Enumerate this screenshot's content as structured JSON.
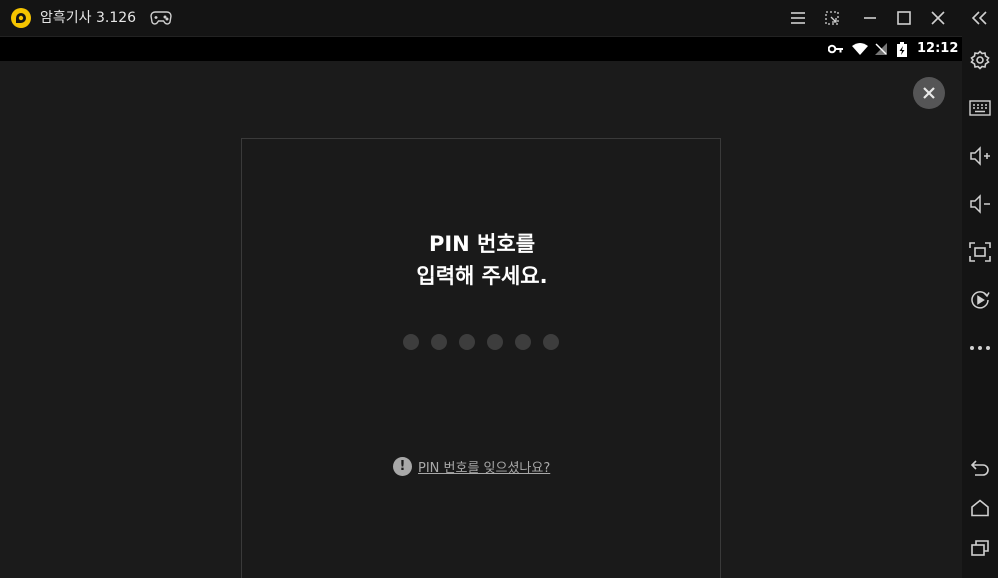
{
  "window": {
    "title": "암흑기사 3.126",
    "logo_icon": "ldplayer-logo-icon",
    "accent_color": "#f5c400"
  },
  "titlebar": {
    "buttons": [
      "menu-icon",
      "resize-icon",
      "minimize-icon",
      "maximize-icon",
      "close-icon"
    ]
  },
  "statusbar": {
    "time": "12:12",
    "icons": [
      "vpn-key-icon",
      "wifi-icon",
      "no-signal-icon",
      "battery-charging-icon"
    ]
  },
  "pin_dialog": {
    "title_line1": "PIN 번호를",
    "title_line2": "입력해 주세요.",
    "dot_count": 6,
    "forgot_icon_glyph": "!",
    "forgot_link": "PIN 번호를 잊으셨나요?"
  },
  "sidebar": {
    "buttons": [
      "collapse-icon",
      "settings-icon",
      "keyboard-icon",
      "volume-up-icon",
      "volume-down-icon",
      "fullscreen-icon",
      "record-icon",
      "more-icon",
      "back-icon",
      "home-icon",
      "recents-icon"
    ]
  }
}
